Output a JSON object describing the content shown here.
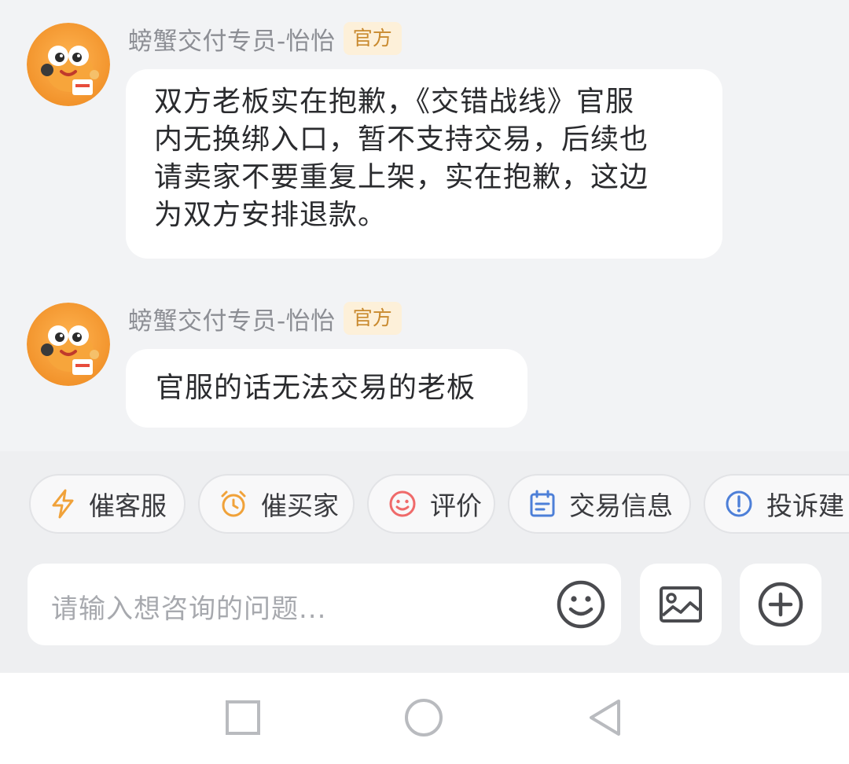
{
  "messages": [
    {
      "sender": "螃蟹交付专员-怡怡",
      "badge": "官方",
      "lines": [
        "双方老板实在抱歉，《交错战线》官服",
        "内无换绑入口，暂不支持交易，后续也",
        "请卖家不要重复上架，实在抱歉，这边",
        "为双方安排退款。"
      ]
    },
    {
      "sender": "螃蟹交付专员-怡怡",
      "badge": "官方",
      "lines": [
        "官服的话无法交易的老板"
      ]
    }
  ],
  "quick_actions": [
    {
      "label": "催客服",
      "icon": "lightning-icon",
      "color": "#f0a23a"
    },
    {
      "label": "催买家",
      "icon": "alarm-clock-icon",
      "color": "#f0a23a"
    },
    {
      "label": "评价",
      "icon": "smile-icon",
      "color": "#ef6a6a"
    },
    {
      "label": "交易信息",
      "icon": "calendar-icon",
      "color": "#4d7fd8"
    },
    {
      "label": "投诉建",
      "icon": "info-icon",
      "color": "#4d7fd8"
    }
  ],
  "input": {
    "placeholder": "请输入想咨询的问题..."
  },
  "colors": {
    "background": "#eeeff1",
    "bubble": "#ffffff",
    "badge_bg": "#fdf0d9",
    "badge_text": "#c98a2f"
  }
}
